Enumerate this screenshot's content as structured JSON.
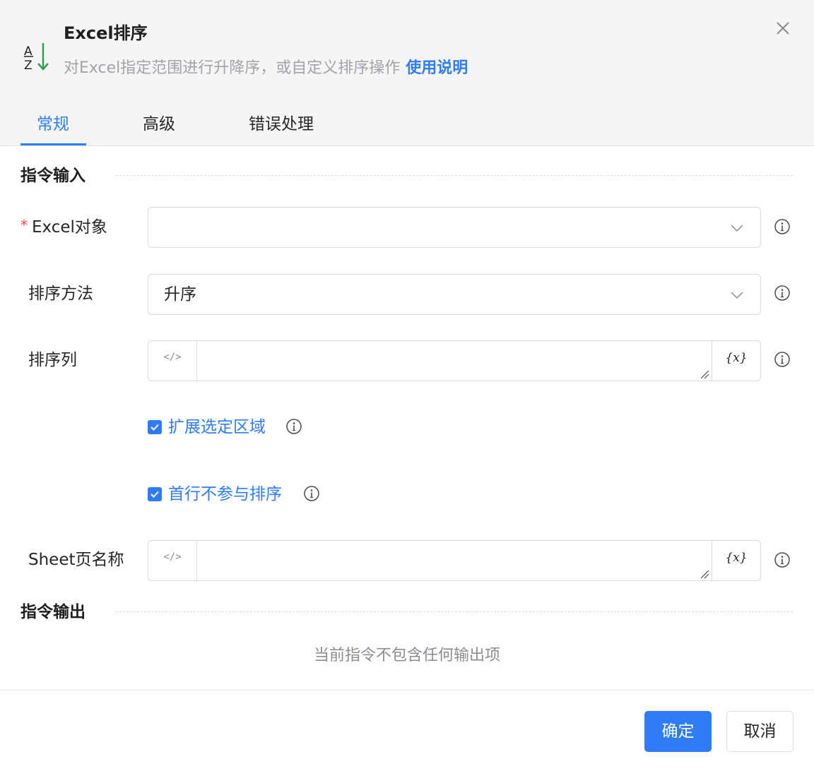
{
  "dialog": {
    "title": "Excel排序",
    "description": "对Excel指定范围进行升降序，或自定义排序操作",
    "help_link": "使用说明",
    "icon": "sort-az-icon",
    "close_icon": "close-icon"
  },
  "tabs": [
    {
      "label": "常规",
      "active": true
    },
    {
      "label": "高级",
      "active": false
    },
    {
      "label": "错误处理",
      "active": false
    }
  ],
  "sections": {
    "input_title": "指令输入",
    "output_title": "指令输出",
    "output_empty": "当前指令不包含任何输出项"
  },
  "fields": {
    "excel_object": {
      "label": "Excel对象",
      "required_mark": "*",
      "value": ""
    },
    "sort_method": {
      "label": "排序方法",
      "value": "升序"
    },
    "sort_column": {
      "label": "排序列",
      "code_symbol": "</>",
      "var_symbol": "{x}",
      "value": ""
    },
    "expand_selection": {
      "label": "扩展选定区域",
      "checked": true
    },
    "skip_first_row": {
      "label": "首行不参与排序",
      "checked": true
    },
    "sheet_name": {
      "label": "Sheet页名称",
      "code_symbol": "</>",
      "var_symbol": "{x}",
      "value": ""
    }
  },
  "footer": {
    "confirm_label": "确定",
    "cancel_label": "取消"
  },
  "colors": {
    "accent": "#2f7cf6",
    "required": "#f5483b",
    "icon_green": "#2e9e4f"
  }
}
